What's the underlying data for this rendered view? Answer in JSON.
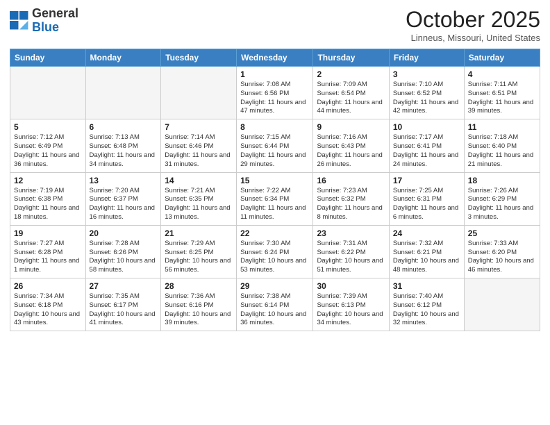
{
  "header": {
    "logo_general": "General",
    "logo_blue": "Blue",
    "month": "October 2025",
    "location": "Linneus, Missouri, United States"
  },
  "days_of_week": [
    "Sunday",
    "Monday",
    "Tuesday",
    "Wednesday",
    "Thursday",
    "Friday",
    "Saturday"
  ],
  "weeks": [
    [
      {
        "day": "",
        "info": ""
      },
      {
        "day": "",
        "info": ""
      },
      {
        "day": "",
        "info": ""
      },
      {
        "day": "1",
        "info": "Sunrise: 7:08 AM\nSunset: 6:56 PM\nDaylight: 11 hours and 47 minutes."
      },
      {
        "day": "2",
        "info": "Sunrise: 7:09 AM\nSunset: 6:54 PM\nDaylight: 11 hours and 44 minutes."
      },
      {
        "day": "3",
        "info": "Sunrise: 7:10 AM\nSunset: 6:52 PM\nDaylight: 11 hours and 42 minutes."
      },
      {
        "day": "4",
        "info": "Sunrise: 7:11 AM\nSunset: 6:51 PM\nDaylight: 11 hours and 39 minutes."
      }
    ],
    [
      {
        "day": "5",
        "info": "Sunrise: 7:12 AM\nSunset: 6:49 PM\nDaylight: 11 hours and 36 minutes."
      },
      {
        "day": "6",
        "info": "Sunrise: 7:13 AM\nSunset: 6:48 PM\nDaylight: 11 hours and 34 minutes."
      },
      {
        "day": "7",
        "info": "Sunrise: 7:14 AM\nSunset: 6:46 PM\nDaylight: 11 hours and 31 minutes."
      },
      {
        "day": "8",
        "info": "Sunrise: 7:15 AM\nSunset: 6:44 PM\nDaylight: 11 hours and 29 minutes."
      },
      {
        "day": "9",
        "info": "Sunrise: 7:16 AM\nSunset: 6:43 PM\nDaylight: 11 hours and 26 minutes."
      },
      {
        "day": "10",
        "info": "Sunrise: 7:17 AM\nSunset: 6:41 PM\nDaylight: 11 hours and 24 minutes."
      },
      {
        "day": "11",
        "info": "Sunrise: 7:18 AM\nSunset: 6:40 PM\nDaylight: 11 hours and 21 minutes."
      }
    ],
    [
      {
        "day": "12",
        "info": "Sunrise: 7:19 AM\nSunset: 6:38 PM\nDaylight: 11 hours and 18 minutes."
      },
      {
        "day": "13",
        "info": "Sunrise: 7:20 AM\nSunset: 6:37 PM\nDaylight: 11 hours and 16 minutes."
      },
      {
        "day": "14",
        "info": "Sunrise: 7:21 AM\nSunset: 6:35 PM\nDaylight: 11 hours and 13 minutes."
      },
      {
        "day": "15",
        "info": "Sunrise: 7:22 AM\nSunset: 6:34 PM\nDaylight: 11 hours and 11 minutes."
      },
      {
        "day": "16",
        "info": "Sunrise: 7:23 AM\nSunset: 6:32 PM\nDaylight: 11 hours and 8 minutes."
      },
      {
        "day": "17",
        "info": "Sunrise: 7:25 AM\nSunset: 6:31 PM\nDaylight: 11 hours and 6 minutes."
      },
      {
        "day": "18",
        "info": "Sunrise: 7:26 AM\nSunset: 6:29 PM\nDaylight: 11 hours and 3 minutes."
      }
    ],
    [
      {
        "day": "19",
        "info": "Sunrise: 7:27 AM\nSunset: 6:28 PM\nDaylight: 11 hours and 1 minute."
      },
      {
        "day": "20",
        "info": "Sunrise: 7:28 AM\nSunset: 6:26 PM\nDaylight: 10 hours and 58 minutes."
      },
      {
        "day": "21",
        "info": "Sunrise: 7:29 AM\nSunset: 6:25 PM\nDaylight: 10 hours and 56 minutes."
      },
      {
        "day": "22",
        "info": "Sunrise: 7:30 AM\nSunset: 6:24 PM\nDaylight: 10 hours and 53 minutes."
      },
      {
        "day": "23",
        "info": "Sunrise: 7:31 AM\nSunset: 6:22 PM\nDaylight: 10 hours and 51 minutes."
      },
      {
        "day": "24",
        "info": "Sunrise: 7:32 AM\nSunset: 6:21 PM\nDaylight: 10 hours and 48 minutes."
      },
      {
        "day": "25",
        "info": "Sunrise: 7:33 AM\nSunset: 6:20 PM\nDaylight: 10 hours and 46 minutes."
      }
    ],
    [
      {
        "day": "26",
        "info": "Sunrise: 7:34 AM\nSunset: 6:18 PM\nDaylight: 10 hours and 43 minutes."
      },
      {
        "day": "27",
        "info": "Sunrise: 7:35 AM\nSunset: 6:17 PM\nDaylight: 10 hours and 41 minutes."
      },
      {
        "day": "28",
        "info": "Sunrise: 7:36 AM\nSunset: 6:16 PM\nDaylight: 10 hours and 39 minutes."
      },
      {
        "day": "29",
        "info": "Sunrise: 7:38 AM\nSunset: 6:14 PM\nDaylight: 10 hours and 36 minutes."
      },
      {
        "day": "30",
        "info": "Sunrise: 7:39 AM\nSunset: 6:13 PM\nDaylight: 10 hours and 34 minutes."
      },
      {
        "day": "31",
        "info": "Sunrise: 7:40 AM\nSunset: 6:12 PM\nDaylight: 10 hours and 32 minutes."
      },
      {
        "day": "",
        "info": ""
      }
    ]
  ]
}
